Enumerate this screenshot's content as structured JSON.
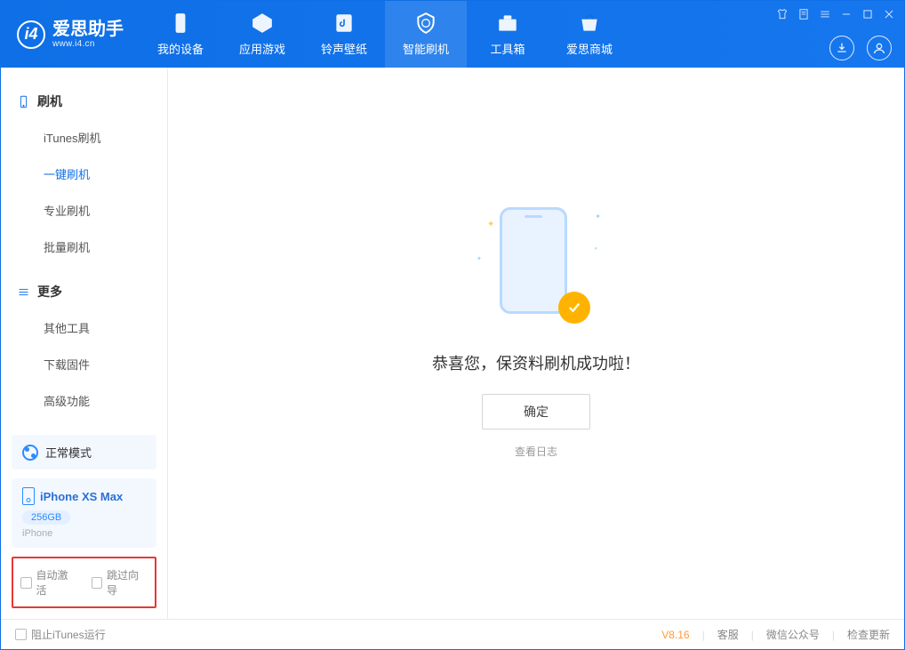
{
  "logo": {
    "title": "爱思助手",
    "subtitle": "www.i4.cn",
    "mark": "i4"
  },
  "tabs": [
    {
      "label": "我的设备"
    },
    {
      "label": "应用游戏"
    },
    {
      "label": "铃声壁纸"
    },
    {
      "label": "智能刷机"
    },
    {
      "label": "工具箱"
    },
    {
      "label": "爱思商城"
    }
  ],
  "sidebar": {
    "group1": {
      "title": "刷机",
      "items": [
        "iTunes刷机",
        "一键刷机",
        "专业刷机",
        "批量刷机"
      ]
    },
    "group2": {
      "title": "更多",
      "items": [
        "其他工具",
        "下载固件",
        "高级功能"
      ]
    }
  },
  "mode": {
    "label": "正常模式"
  },
  "device": {
    "name": "iPhone XS Max",
    "storage": "256GB",
    "type": "iPhone"
  },
  "options": {
    "auto_activate": "自动激活",
    "skip_guide": "跳过向导"
  },
  "result": {
    "message": "恭喜您，保资料刷机成功啦！",
    "ok": "确定",
    "log": "查看日志"
  },
  "footer": {
    "block_itunes": "阻止iTunes运行",
    "version": "V8.16",
    "service": "客服",
    "wechat": "微信公众号",
    "update": "检查更新"
  }
}
